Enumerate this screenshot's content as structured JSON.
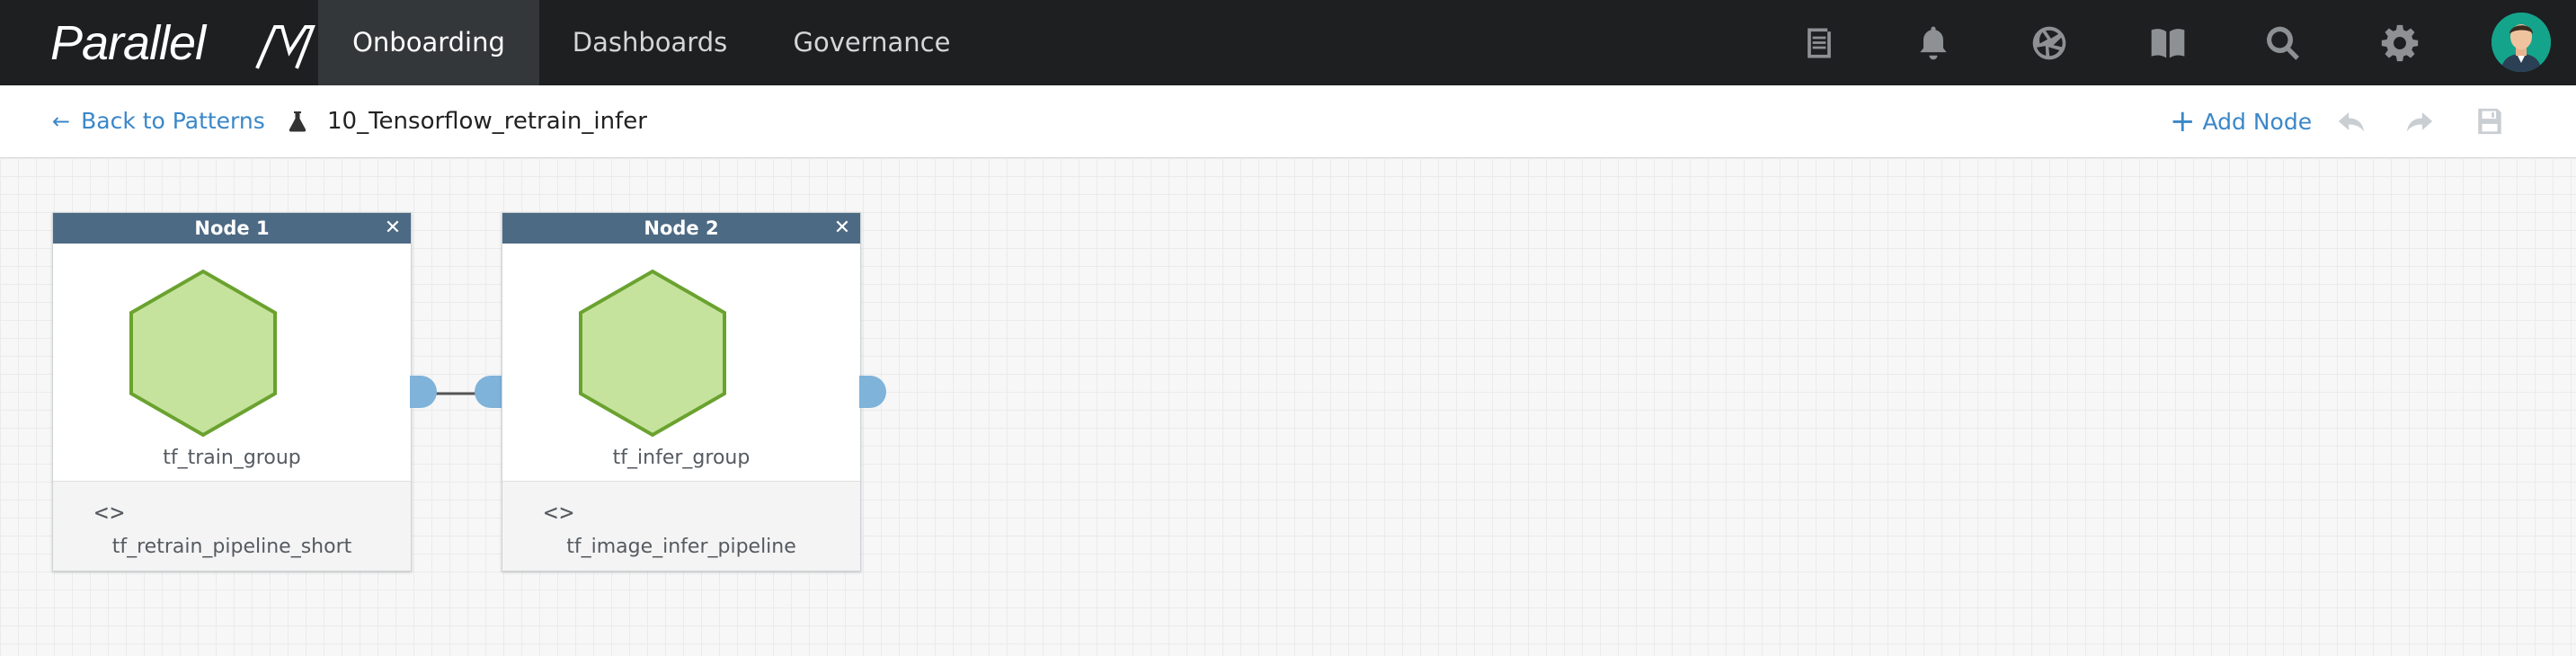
{
  "app": {
    "logo_text": "Parallel",
    "logo_mark": "M"
  },
  "nav": {
    "tabs": [
      {
        "label": "Onboarding",
        "active": true
      },
      {
        "label": "Dashboards",
        "active": false
      },
      {
        "label": "Governance",
        "active": false
      }
    ],
    "icons": [
      "document-icon",
      "bell-icon",
      "aperture-icon",
      "book-icon",
      "search-icon",
      "gear-icon",
      "avatar"
    ]
  },
  "toolbar": {
    "back_label": "Back to Patterns",
    "pattern_name": "10_Tensorflow_retrain_infer",
    "add_node_label": "Add Node",
    "icons": [
      "undo-icon",
      "redo-icon",
      "save-icon"
    ]
  },
  "nodes": [
    {
      "title": "Node 1",
      "group": "tf_train_group",
      "pipeline": "tf_retrain_pipeline_short"
    },
    {
      "title": "Node 2",
      "group": "tf_infer_group",
      "pipeline": "tf_image_infer_pipeline"
    }
  ],
  "colors": {
    "nav_bg": "#1d1f21",
    "accent": "#3a87c8",
    "node_header": "#4d6a84",
    "hex_fill": "#c5e39c",
    "hex_stroke": "#6aa22f",
    "port": "#7fb3da"
  }
}
